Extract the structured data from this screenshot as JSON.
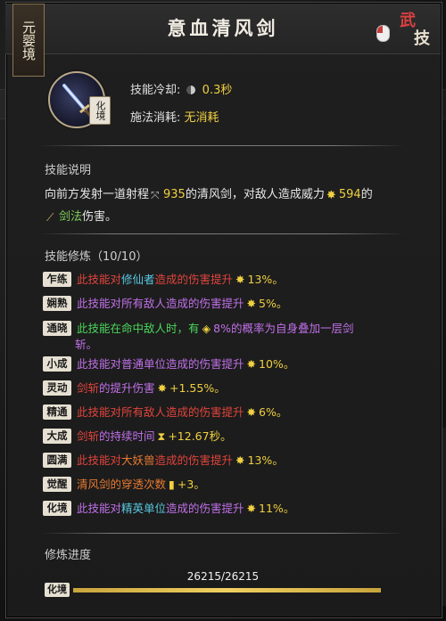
{
  "header": {
    "realm": "元婴境",
    "title": "意血清风剑",
    "type_seal": [
      "武",
      "技"
    ]
  },
  "skill": {
    "tier": "化境",
    "cooldown_label": "技能冷却:",
    "cooldown_value": "0.3秒",
    "cost_label": "施法消耗:",
    "cost_value": "无消耗"
  },
  "description": {
    "title": "技能说明",
    "pre": "向前方发射一道射程",
    "range": "935",
    "mid": "的清风剑，对敌人造成威力",
    "power": "594",
    "post1": "的",
    "sword_law": "剑法",
    "post2": "伤害。"
  },
  "cultivation": {
    "title": "技能修炼（10/10）",
    "rows": [
      {
        "tag": "乍练",
        "parts": [
          {
            "t": "此技能对",
            "c": "red"
          },
          {
            "t": "修仙者",
            "c": "cyan"
          },
          {
            "t": "造成的伤害提升",
            "c": "red"
          },
          {
            "t": "13%。",
            "c": "yellow",
            "icon": "✸"
          }
        ]
      },
      {
        "tag": "娴熟",
        "parts": [
          {
            "t": "此技能对",
            "c": "purple"
          },
          {
            "t": "所有敌人",
            "c": "purple"
          },
          {
            "t": "造成的伤害提升",
            "c": "purple"
          },
          {
            "t": "5%。",
            "c": "yellow",
            "icon": "✸"
          }
        ]
      },
      {
        "tag": "通晓",
        "parts": [
          {
            "t": "此技能在命中敌人时，有",
            "c": "green"
          },
          {
            "t": "8%的概率为自身叠加一层剑",
            "c": "purple",
            "icon": "◈"
          }
        ]
      },
      {
        "tag": "",
        "parts": [
          {
            "t": "斩。",
            "c": "purple"
          }
        ]
      },
      {
        "tag": "小成",
        "parts": [
          {
            "t": "此技能对",
            "c": "purple"
          },
          {
            "t": "普通单位",
            "c": "purple"
          },
          {
            "t": "造成的伤害提升",
            "c": "purple"
          },
          {
            "t": "10%。",
            "c": "yellow",
            "icon": "✸"
          }
        ]
      },
      {
        "tag": "灵动",
        "parts": [
          {
            "t": "剑斩",
            "c": "red"
          },
          {
            "t": "的提升伤害",
            "c": "purple"
          },
          {
            "t": "+1.55%。",
            "c": "yellow",
            "icon": "✸"
          }
        ]
      },
      {
        "tag": "精通",
        "parts": [
          {
            "t": "此技能对",
            "c": "red"
          },
          {
            "t": "所有敌人",
            "c": "red"
          },
          {
            "t": "造成的伤害提升",
            "c": "red"
          },
          {
            "t": "6%。",
            "c": "yellow",
            "icon": "✸"
          }
        ]
      },
      {
        "tag": "大成",
        "parts": [
          {
            "t": "剑斩",
            "c": "red"
          },
          {
            "t": "的持续时间",
            "c": "purple"
          },
          {
            "t": "+12.67秒。",
            "c": "yellow",
            "icon": "⧗"
          }
        ]
      },
      {
        "tag": "圆满",
        "parts": [
          {
            "t": "此技能对",
            "c": "red"
          },
          {
            "t": "大妖兽",
            "c": "orange"
          },
          {
            "t": "造成的伤害提升",
            "c": "red"
          },
          {
            "t": "13%。",
            "c": "yellow",
            "icon": "✸"
          }
        ]
      },
      {
        "tag": "觉醒",
        "parts": [
          {
            "t": "清风剑的穿透次数",
            "c": "orange"
          },
          {
            "t": "+3。",
            "c": "yellow",
            "icon": "▮"
          }
        ]
      },
      {
        "tag": "化境",
        "parts": [
          {
            "t": "此技能对",
            "c": "purple"
          },
          {
            "t": "精英单位",
            "c": "cyan"
          },
          {
            "t": "造成的伤害提升",
            "c": "purple"
          },
          {
            "t": "11%。",
            "c": "yellow",
            "icon": "✸"
          }
        ]
      }
    ]
  },
  "progress": {
    "title": "修炼进度",
    "text": "26215/26215",
    "tag": "化境",
    "fraction": 1.0
  },
  "colors": {
    "red": "#e0443c",
    "purple": "#c070e8",
    "cyan": "#58c8e0",
    "green": "#4ad65a",
    "yellow": "#f0d040",
    "orange": "#e87a30"
  }
}
